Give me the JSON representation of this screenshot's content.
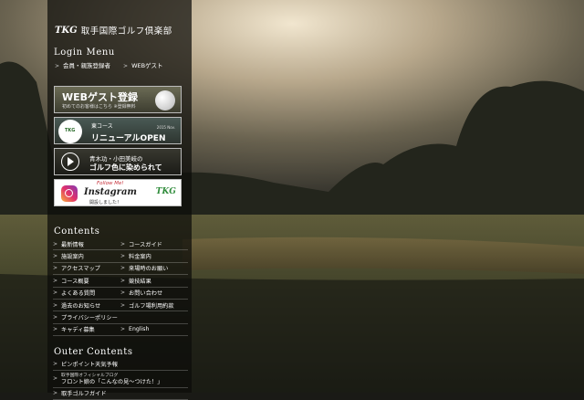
{
  "logo": {
    "mark": "TKG",
    "name": "取手国際ゴルフ倶楽部"
  },
  "login": {
    "title": "Login Menu",
    "links": [
      "会員・親族登録者",
      "WEBゲスト"
    ]
  },
  "banners": {
    "web_guest": {
      "title": "WEBゲスト登録",
      "sub": "初めてのお客様はこちら ※登録無料"
    },
    "east_course": {
      "badge": "TKG",
      "small": "東コース",
      "date": "2015 Nov.",
      "big": "リニューアルOPEN"
    },
    "video": {
      "line1": "青木功・小田美岐の",
      "line2": "ゴルフ色に染められて"
    },
    "instagram": {
      "follow": "Follow Me!",
      "name": "Instagram",
      "note": "開設しました！",
      "brand": "TKG"
    }
  },
  "contents": {
    "title": "Contents",
    "rows": [
      [
        "最新情報",
        "コースガイド"
      ],
      [
        "施設案内",
        "料金案内"
      ],
      [
        "アクセスマップ",
        "来場時のお願い"
      ],
      [
        "コース概要",
        "競技結果"
      ],
      [
        "よくある質問",
        "お問い合わせ"
      ],
      [
        "過去のお知らせ",
        "ゴルフ場利用約款"
      ],
      [
        "プライバシーポリシー"
      ],
      [
        "キャディ募集",
        "English"
      ]
    ]
  },
  "outer": {
    "title": "Outer Contents",
    "items": [
      {
        "text": "ピンポイント天気予報"
      },
      {
        "small": "取手国際オフィシャルブログ",
        "text": "フロント娘の「こんなの見〜つけた！」"
      },
      {
        "text": "取手ゴルフガイド"
      }
    ]
  }
}
